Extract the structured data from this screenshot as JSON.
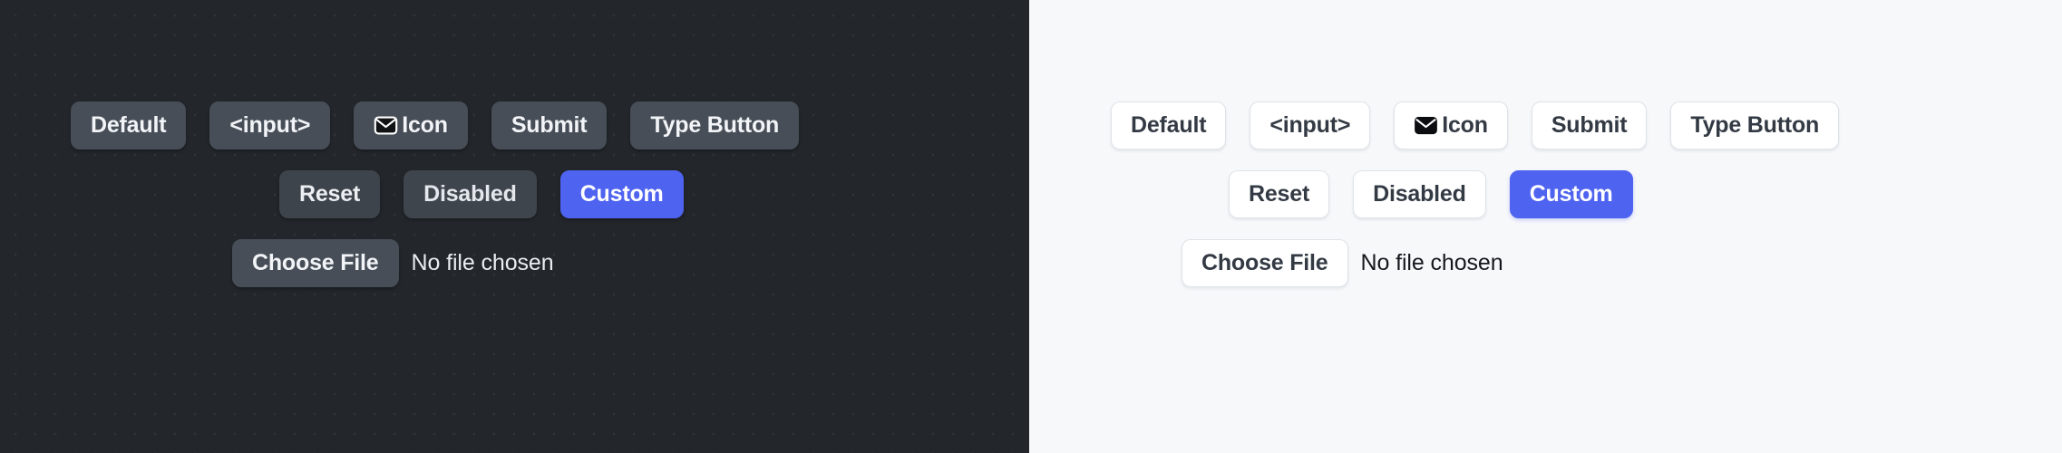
{
  "panels": [
    {
      "theme": "dark",
      "background": "#23272c",
      "rows": [
        {
          "buttons": [
            {
              "label": "Default",
              "variant": "default"
            },
            {
              "label": "<input>",
              "variant": "default"
            },
            {
              "label": "Icon",
              "variant": "default",
              "icon": "envelope-icon"
            },
            {
              "label": "Submit",
              "variant": "default"
            },
            {
              "label": "Type Button",
              "variant": "default"
            }
          ]
        },
        {
          "buttons": [
            {
              "label": "Reset",
              "variant": "muted"
            },
            {
              "label": "Disabled",
              "variant": "disabled"
            },
            {
              "label": "Custom",
              "variant": "custom"
            }
          ]
        }
      ],
      "file_input": {
        "button_label": "Choose File",
        "status_text": "No file chosen"
      }
    },
    {
      "theme": "light",
      "background": "#f7f8fa",
      "rows": [
        {
          "buttons": [
            {
              "label": "Default",
              "variant": "default"
            },
            {
              "label": "<input>",
              "variant": "default"
            },
            {
              "label": "Icon",
              "variant": "default",
              "icon": "envelope-icon"
            },
            {
              "label": "Submit",
              "variant": "default"
            },
            {
              "label": "Type Button",
              "variant": "default"
            }
          ]
        },
        {
          "buttons": [
            {
              "label": "Reset",
              "variant": "muted"
            },
            {
              "label": "Disabled",
              "variant": "disabled"
            },
            {
              "label": "Custom",
              "variant": "custom"
            }
          ]
        }
      ],
      "file_input": {
        "button_label": "Choose File",
        "status_text": "No file chosen"
      }
    }
  ],
  "colors": {
    "accent_custom": "#4e63f0",
    "dark_surface": "#474e57",
    "dark_background": "#23272c",
    "light_background": "#f7f8fa",
    "light_border": "#dfe3e8",
    "light_text": "#333a44",
    "dark_text": "#f2f4f7"
  }
}
